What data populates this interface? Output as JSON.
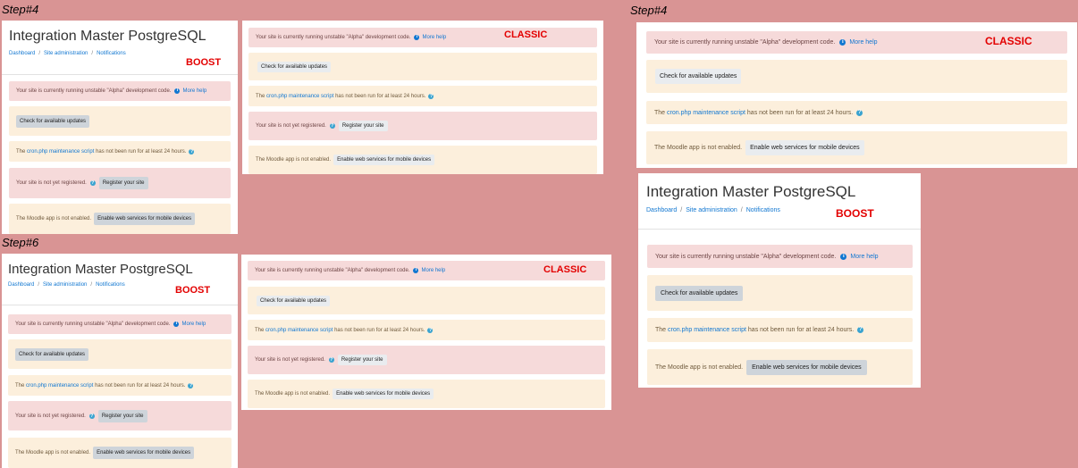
{
  "labels": {
    "step4": "Step#4",
    "step6": "Step#6"
  },
  "site_title": "Integration Master PostgreSQL",
  "breadcrumb": [
    "Dashboard",
    "Site administration",
    "Notifications"
  ],
  "tags": {
    "boost": "BOOST",
    "classic": "CLASSIC"
  },
  "alerts": {
    "alpha_text": "Your site is currently running unstable \"Alpha\" development code.",
    "more_help": "More help",
    "check_updates": "Check for available updates",
    "cron_link": "cron.php maintenance script",
    "cron_pre": "The ",
    "cron_post": " has not been run for at least 24 hours.",
    "not_registered": "Your site is not yet registered.",
    "register_btn": "Register your site",
    "app_text": "The Moodle app is not enabled.",
    "enable_btn": "Enable web services for mobile devices"
  },
  "icons": {
    "info": "info-circle-icon",
    "help": "question-circle-icon"
  },
  "colors": {
    "background": "#d99494",
    "error_bg": "#f6dada",
    "warn_bg": "#fcefdc",
    "link": "#1177d1",
    "tag": "#e30000"
  }
}
